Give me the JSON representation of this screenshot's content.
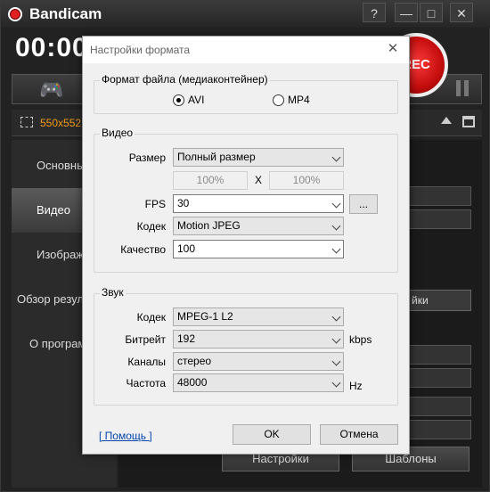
{
  "app": {
    "title": "Bandicam",
    "timer": "00:00",
    "rec_label": "REC",
    "minimize_label": "—",
    "close_label": "✕",
    "help_label": "?",
    "region_text": "550x552 -",
    "gamepad_glyph": "🎮"
  },
  "sidebar": {
    "items": [
      {
        "label": "Основные"
      },
      {
        "label": "Видео"
      },
      {
        "label": "Изображения"
      },
      {
        "label": "Обзор результатов"
      },
      {
        "label": "О программе"
      }
    ]
  },
  "background": {
    "settings_label": "Настройки",
    "templates_label": "Шаблоны",
    "right_settings_label": "йки"
  },
  "dialog": {
    "title": "Настройки формата",
    "close_glyph": "✕",
    "container": {
      "legend": "Формат файла (медиаконтейнер)",
      "options": [
        "AVI",
        "MP4"
      ],
      "selected": "AVI"
    },
    "video": {
      "legend": "Видео",
      "size_label": "Размер",
      "size_value": "Полный размер",
      "width_percent": "100%",
      "x_label": "X",
      "height_percent": "100%",
      "fps_label": "FPS",
      "fps_value": "30",
      "fps_more": "...",
      "codec_label": "Кодек",
      "codec_value": "Motion JPEG",
      "quality_label": "Качество",
      "quality_value": "100"
    },
    "audio": {
      "legend": "Звук",
      "codec_label": "Кодек",
      "codec_value": "MPEG-1 L2",
      "bitrate_label": "Битрейт",
      "bitrate_value": "192",
      "bitrate_unit": "kbps",
      "channels_label": "Каналы",
      "channels_value": "стерео",
      "freq_label": "Частота",
      "freq_value": "48000",
      "freq_unit": "Hz"
    },
    "help_link": "[ Помощь ]",
    "ok_label": "OK",
    "cancel_label": "Отмена"
  },
  "colors": {
    "accent_orange": "#f39c12",
    "rec_red": "#e02020"
  }
}
